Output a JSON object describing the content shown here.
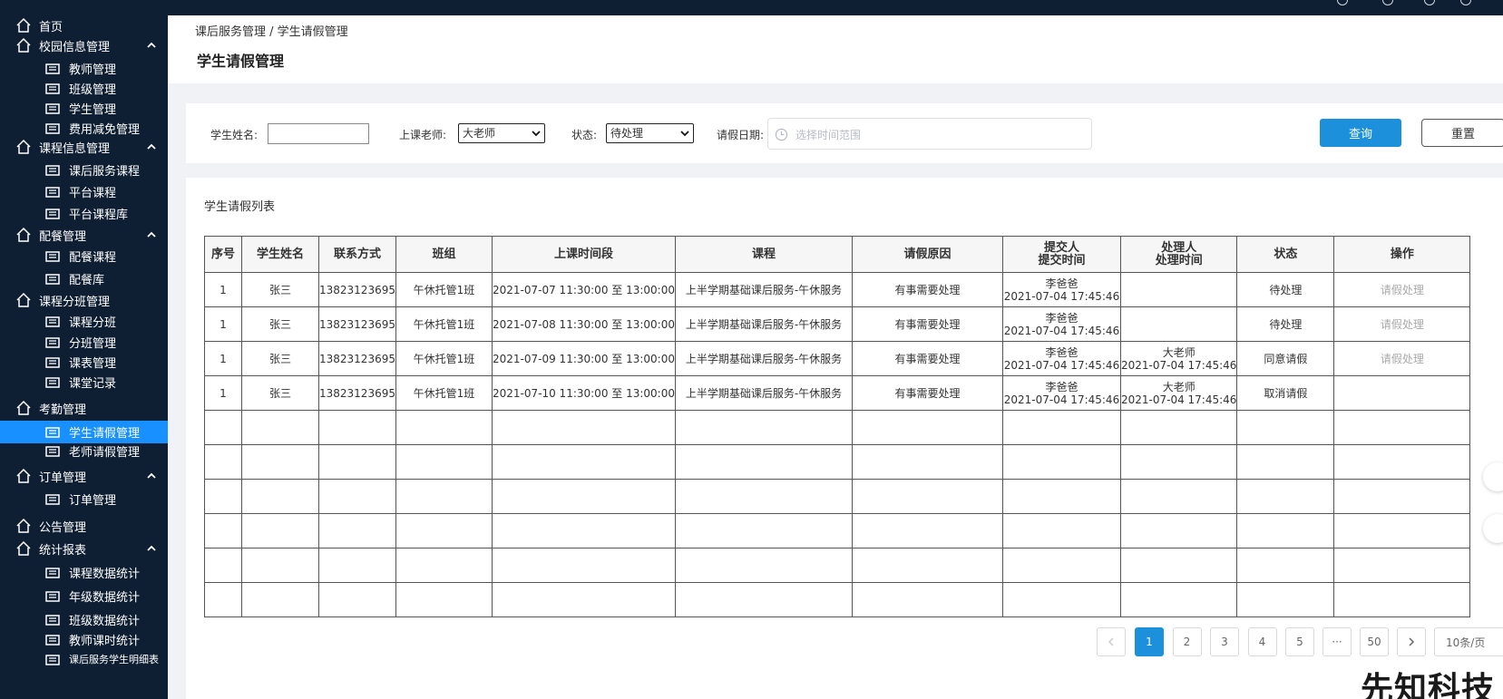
{
  "sidebar": {
    "items": [
      {
        "label": "首页",
        "icon": "home-icon",
        "level": 0,
        "caret": false,
        "active": false
      },
      {
        "label": "校园信息管理",
        "icon": "school-icon",
        "level": 0,
        "caret": true,
        "active": false
      },
      {
        "label": "教师管理",
        "icon": "teacher-icon",
        "level": 1,
        "caret": false,
        "active": false
      },
      {
        "label": "班级管理",
        "icon": "class-icon",
        "level": 1,
        "caret": false,
        "active": false
      },
      {
        "label": "学生管理",
        "icon": "student-icon",
        "level": 1,
        "caret": false,
        "active": false
      },
      {
        "label": "费用减免管理",
        "icon": "fee-icon",
        "level": 1,
        "caret": false,
        "active": false
      },
      {
        "label": "课程信息管理",
        "icon": "book-icon",
        "level": 0,
        "caret": true,
        "active": false
      },
      {
        "label": "课后服务课程",
        "icon": "service-icon",
        "level": 1,
        "caret": false,
        "active": false
      },
      {
        "label": "平台课程",
        "icon": "flag-icon",
        "level": 1,
        "caret": false,
        "active": false
      },
      {
        "label": "平台课程库",
        "icon": "layers-icon",
        "level": 1,
        "caret": false,
        "active": false
      },
      {
        "label": "配餐管理",
        "icon": "meal-icon",
        "level": 0,
        "caret": true,
        "active": false
      },
      {
        "label": "配餐课程",
        "icon": "meal-course-icon",
        "level": 1,
        "caret": false,
        "active": false
      },
      {
        "label": "配餐库",
        "icon": "grid-icon",
        "level": 1,
        "caret": false,
        "active": false
      },
      {
        "label": "课程分班管理",
        "icon": "split-icon",
        "level": 0,
        "caret": false,
        "active": false
      },
      {
        "label": "课程分班",
        "icon": "course-split-icon",
        "level": 1,
        "caret": false,
        "active": false
      },
      {
        "label": "分班管理",
        "icon": "table-icon",
        "level": 1,
        "caret": false,
        "active": false
      },
      {
        "label": "课表管理",
        "icon": "calendar-icon",
        "level": 1,
        "caret": false,
        "active": false
      },
      {
        "label": "课堂记录",
        "icon": "record-icon",
        "level": 1,
        "caret": false,
        "active": false
      },
      {
        "label": "考勤管理",
        "icon": "attendance-icon",
        "level": 0,
        "caret": false,
        "active": false
      },
      {
        "label": "学生请假管理",
        "icon": "student-leave-icon",
        "level": 1,
        "caret": false,
        "active": true
      },
      {
        "label": "老师请假管理",
        "icon": "teacher-leave-icon",
        "level": 1,
        "caret": false,
        "active": false
      },
      {
        "label": "订单管理",
        "icon": "order-icon",
        "level": 0,
        "caret": true,
        "active": false
      },
      {
        "label": "订单管理",
        "icon": "order-list-icon",
        "level": 1,
        "caret": false,
        "active": false
      },
      {
        "label": "公告管理",
        "icon": "notice-icon",
        "level": 0,
        "caret": false,
        "active": false
      },
      {
        "label": "统计报表",
        "icon": "report-icon",
        "level": 0,
        "caret": true,
        "active": false
      },
      {
        "label": "课程数据统计",
        "icon": "course-stats-icon",
        "level": 1,
        "caret": false,
        "active": false
      },
      {
        "label": "年级数据统计",
        "icon": "bar-chart-icon",
        "level": 1,
        "caret": false,
        "active": false
      },
      {
        "label": "班级数据统计",
        "icon": "class-stats-icon",
        "level": 1,
        "caret": false,
        "active": false
      },
      {
        "label": "教师课时统计",
        "icon": "pie-chart-icon",
        "level": 1,
        "caret": false,
        "active": false
      },
      {
        "label": "课后服务学生明细表",
        "icon": "detail-icon",
        "level": 1,
        "caret": false,
        "active": false
      }
    ]
  },
  "header": {
    "breadcrumb": "课后服务管理 / 学生请假管理",
    "title": "学生请假管理"
  },
  "filter": {
    "student_name_label": "学生姓名:",
    "student_name_value": "",
    "teacher_label": "上课老师:",
    "teacher_value": "大老师",
    "status_label": "状态:",
    "status_value": "待处理",
    "date_label": "请假日期:",
    "date_placeholder": "选择时间范围",
    "query_label": "查询",
    "reset_label": "重置"
  },
  "list": {
    "title": "学生请假列表",
    "columns": [
      "序号",
      "学生姓名",
      "联系方式",
      "班组",
      "上课时间段",
      "课程",
      "请假原因",
      "提交人\n提交时间",
      "处理人\n处理时间",
      "状态",
      "操作"
    ],
    "rows": [
      {
        "index": "1",
        "name": "张三",
        "phone": "13823123695",
        "group": "午休托管1班",
        "period": "2021-07-07 11:30:00 至 13:00:00",
        "course": "上半学期基础课后服务-午休服务",
        "reason": "有事需要处理",
        "submitter": "李爸爸",
        "submit_time": "2021-07-04 17:45:46",
        "handler": "",
        "handle_time": "",
        "status": "待处理",
        "action": "请假处理"
      },
      {
        "index": "1",
        "name": "张三",
        "phone": "13823123695",
        "group": "午休托管1班",
        "period": "2021-07-08 11:30:00 至 13:00:00",
        "course": "上半学期基础课后服务-午休服务",
        "reason": "有事需要处理",
        "submitter": "李爸爸",
        "submit_time": "2021-07-04 17:45:46",
        "handler": "",
        "handle_time": "",
        "status": "待处理",
        "action": "请假处理"
      },
      {
        "index": "1",
        "name": "张三",
        "phone": "13823123695",
        "group": "午休托管1班",
        "period": "2021-07-09 11:30:00 至 13:00:00",
        "course": "上半学期基础课后服务-午休服务",
        "reason": "有事需要处理",
        "submitter": "李爸爸",
        "submit_time": "2021-07-04 17:45:46",
        "handler": "大老师",
        "handle_time": "2021-07-04 17:45:46",
        "status": "同意请假",
        "action": "请假处理"
      },
      {
        "index": "1",
        "name": "张三",
        "phone": "13823123695",
        "group": "午休托管1班",
        "period": "2021-07-10 11:30:00 至 13:00:00",
        "course": "上半学期基础课后服务-午休服务",
        "reason": "有事需要处理",
        "submitter": "李爸爸",
        "submit_time": "2021-07-04 17:45:46",
        "handler": "大老师",
        "handle_time": "2021-07-04 17:45:46",
        "status": "取消请假",
        "action": ""
      }
    ],
    "empty_rows": 6
  },
  "pagination": {
    "pages": [
      "1",
      "2",
      "3",
      "4",
      "5"
    ],
    "current": "1",
    "last_page": "50",
    "page_size": "10条/页"
  },
  "watermark": "先知科技",
  "colors": {
    "sidebar_bg": "#0f1f33",
    "accent": "#1c90da",
    "active_nav": "#1890ff"
  }
}
